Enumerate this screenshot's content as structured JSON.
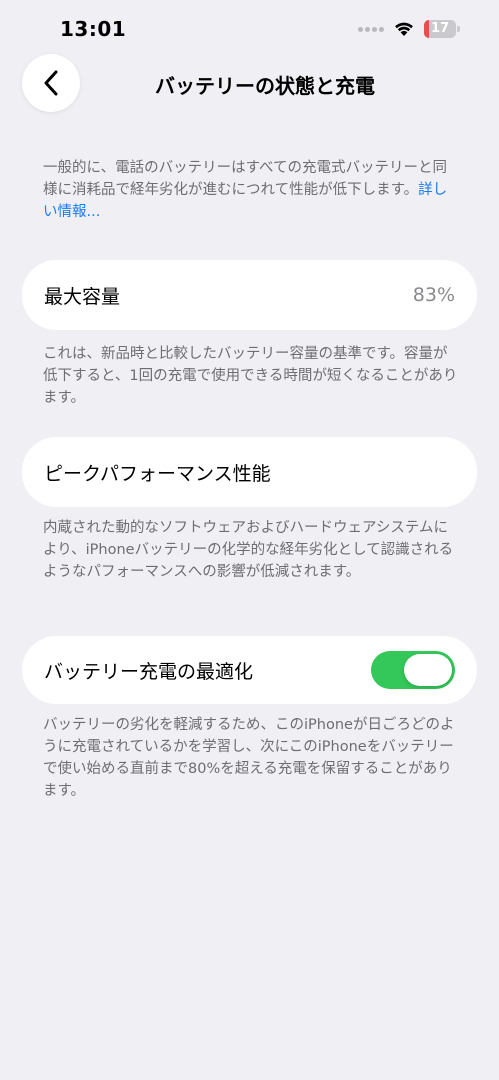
{
  "status_bar": {
    "time": "13:01",
    "battery_level": "17",
    "battery_fraction": 0.17,
    "battery_color": "#eb4d4d"
  },
  "nav": {
    "back_icon": "chevron-left-icon",
    "title": "バッテリーの状態と充電"
  },
  "intro": {
    "text": "一般的に、電話のバッテリーはすべての充電式バッテリーと同様に消耗品で経年劣化が進むにつれて性能が低下します。",
    "link": "詳しい情報..."
  },
  "max_capacity": {
    "label": "最大容量",
    "value": "83%",
    "description": "これは、新品時と比較したバッテリー容量の基準です。容量が低下すると、1回の充電で使用できる時間が短くなることがあります。"
  },
  "peak_performance": {
    "label": "ピークパフォーマンス性能",
    "description": "内蔵された動的なソフトウェアおよびハードウェアシステムにより、iPhoneバッテリーの化学的な経年劣化として認識されるようなパフォーマンスへの影響が低減されます。"
  },
  "optimized_charging": {
    "label": "バッテリー充電の最適化",
    "enabled": true,
    "toggle_color": "#34c759",
    "description": "バッテリーの劣化を軽減するため、このiPhoneが日ごろどのように充電されているかを学習し、次にこのiPhoneをバッテリーで使い始める直前まで80%を超える充電を保留することがあります。"
  }
}
